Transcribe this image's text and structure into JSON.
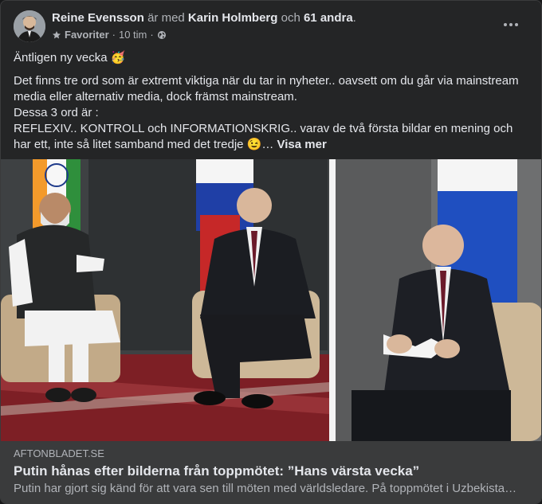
{
  "post": {
    "author": "Reine Evensson",
    "with_text": "är med",
    "tagged_person": "Karin Holmberg",
    "and_text": "och",
    "others": "61 andra",
    "period": ".",
    "favorites_label": "Favoriter",
    "time": "10 tim",
    "separator": "·",
    "avatar_icon": "profile-photo",
    "audience_icon": "globe-icon",
    "favorites_icon": "star-icon",
    "more_icon": "ellipsis-icon"
  },
  "body": {
    "line1": "Äntligen ny vecka",
    "line1_emoji": "🥳",
    "para1": "Det finns tre ord som är extremt viktiga när du tar in nyheter.. oavsett om du går via mainstream media eller alternativ media, dock främst mainstream.",
    "para2": "Dessa 3 ord är :",
    "para3": "REFLEXIV.. KONTROLL och INFORMATIONSKRIG.. varav de två första bildar en mening och har ett, inte så litet samband med det tredje",
    "para3_emoji": "😉",
    "ellipsis": "…",
    "see_more": "Visa mer"
  },
  "link": {
    "domain": "AFTONBLADET.SE",
    "title": "Putin hånas efter bilderna från toppmötet: ”Hans värsta vecka”",
    "description": "Putin har gjort sig känd för att vara sen till möten med världsledare. På toppmötet i Uzbekista…"
  },
  "colors": {
    "card_bg": "#242526",
    "link_bg": "#3a3b3c",
    "primary_text": "#e4e6eb",
    "secondary_text": "#b0b3b8"
  }
}
